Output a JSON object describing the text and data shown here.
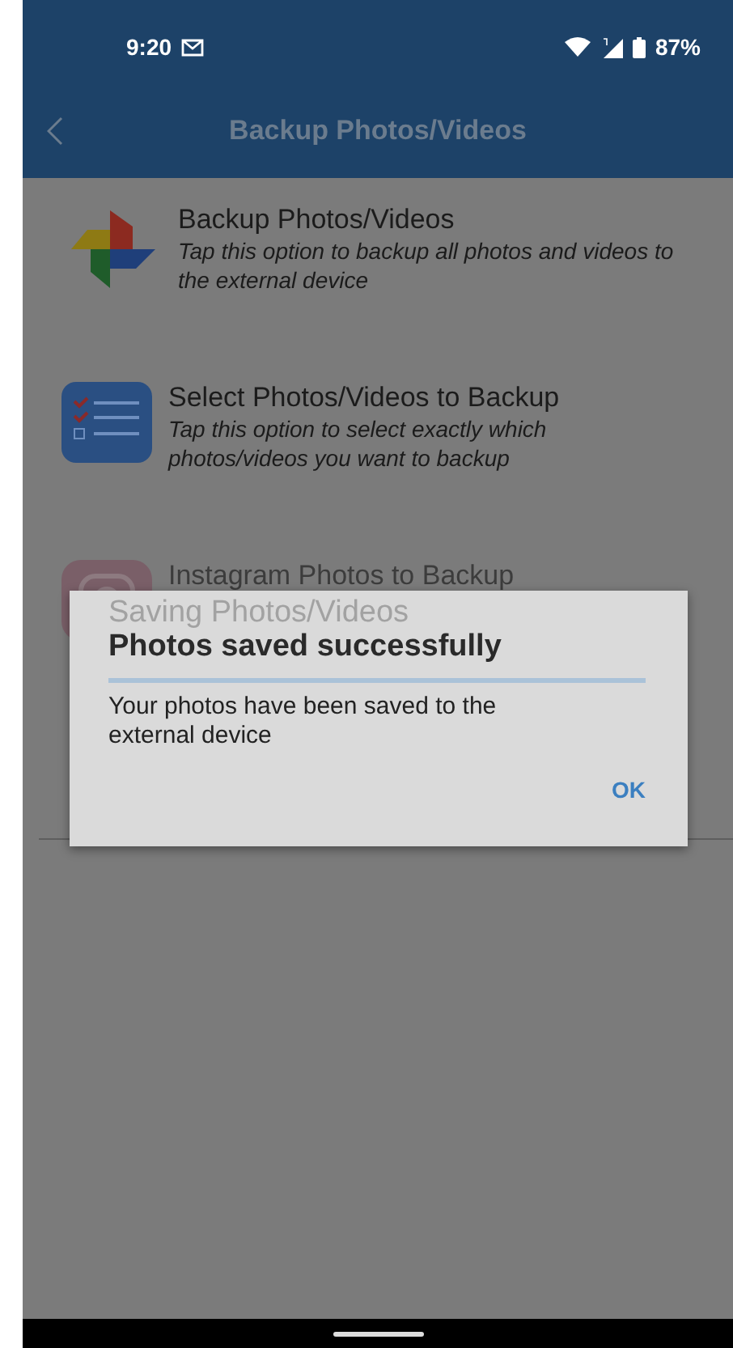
{
  "status_bar": {
    "time": "9:20",
    "battery": "87%"
  },
  "app_bar": {
    "title": "Backup Photos/Videos"
  },
  "options": [
    {
      "kind": "pinwheel",
      "title": "Backup Photos/Videos",
      "subtitle": "Tap this option to backup all photos and videos to the external device"
    },
    {
      "kind": "checklist",
      "title": "Select Photos/Videos to Backup",
      "subtitle": "Tap this option to select exactly which photos/videos you want to backup"
    },
    {
      "kind": "camera",
      "title": "Instagram Photos to Backup"
    }
  ],
  "dialog": {
    "previous_title": "Saving Photos/Videos",
    "title": "Photos saved successfully",
    "message": "Your photos have been saved to the external device",
    "buttons": [
      "OK"
    ]
  }
}
